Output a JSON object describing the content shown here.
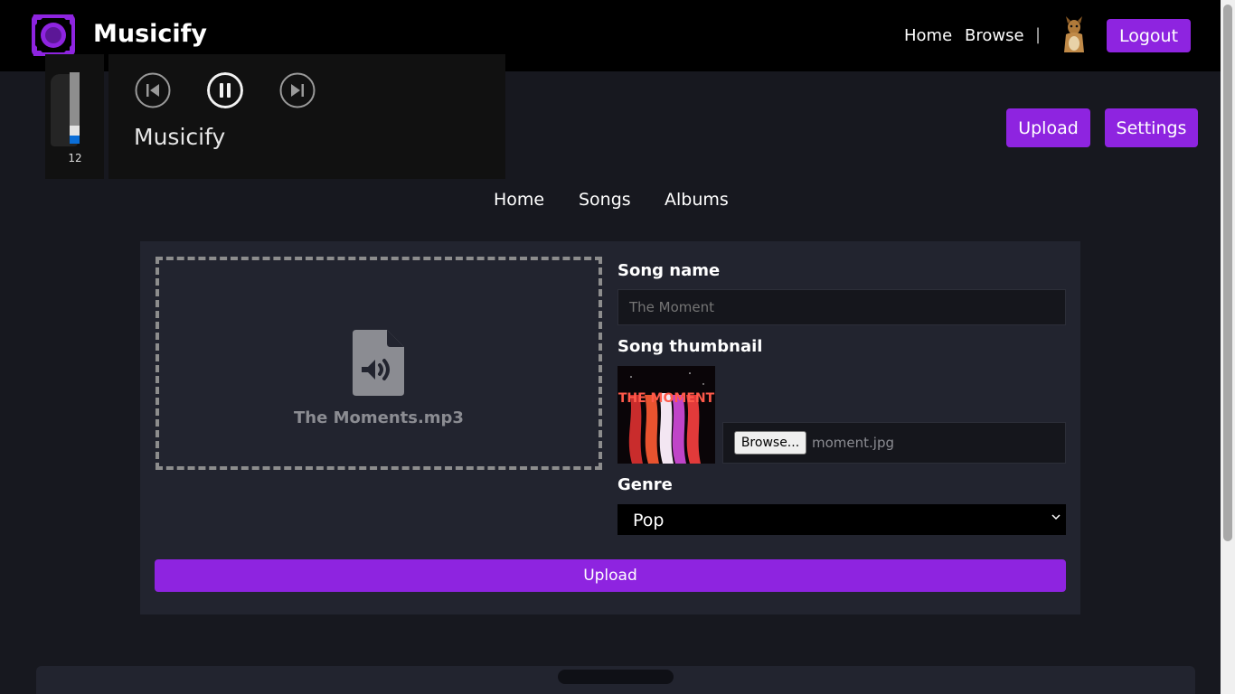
{
  "header": {
    "brand": "Musicify",
    "nav": {
      "home": "Home",
      "browse": "Browse",
      "separator": "|"
    },
    "logout_label": "Logout",
    "accent_color": "#8e24e0"
  },
  "player": {
    "title": "Musicify",
    "volume": 12,
    "controls": [
      "skip-previous-icon",
      "pause-icon",
      "skip-next-icon"
    ]
  },
  "actions": {
    "upload_label": "Upload",
    "settings_label": "Settings"
  },
  "subnav": {
    "home": "Home",
    "songs": "Songs",
    "albums": "Albums"
  },
  "form": {
    "file_name": "The Moments.mp3",
    "song_name_label": "Song name",
    "song_name_placeholder": "The Moment",
    "thumbnail_label": "Song thumbnail",
    "thumbnail_title": "THE MOMENT",
    "browse_label": "Browse...",
    "thumbnail_file": "moment.jpg",
    "genre_label": "Genre",
    "genre_value": "Pop",
    "submit_label": "Upload"
  }
}
